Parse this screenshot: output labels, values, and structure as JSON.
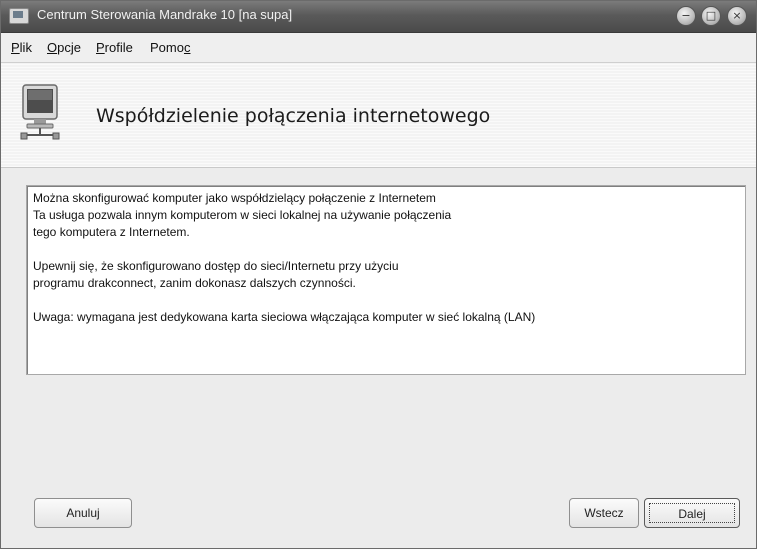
{
  "window": {
    "title": "Centrum Sterowania Mandrake 10 [na supa]",
    "buttons": {
      "minimize": "−",
      "maximize": "□",
      "close": "×"
    }
  },
  "menu": [
    {
      "prefix": "",
      "underlined": "P",
      "rest": "lik"
    },
    {
      "prefix": "",
      "underlined": "O",
      "rest": "pcje"
    },
    {
      "prefix": "",
      "underlined": "P",
      "rest": "rofile"
    },
    {
      "prefix": "Pomo",
      "underlined": "c",
      "rest": ""
    }
  ],
  "header": {
    "title": "Współdzielenie połączenia internetowego",
    "icon": "network-computer-icon"
  },
  "body": {
    "lines": [
      "Można skonfigurować komputer jako współdzielący połączenie z Internetem",
      "Ta usługa pozwala innym komputerom w sieci lokalnej na używanie połączenia",
      "tego komputera z Internetem.",
      "",
      "Upewnij się, że skonfigurowano dostęp do sieci/Internetu przy użyciu",
      "programu drakconnect, zanim dokonasz dalszych czynności.",
      "",
      "Uwaga:  wymagana jest dedykowana karta sieciowa włączająca komputer w sieć lokalną (LAN)"
    ]
  },
  "buttons": {
    "cancel": "Anuluj",
    "back": "Wstecz",
    "next": "Dalej"
  }
}
